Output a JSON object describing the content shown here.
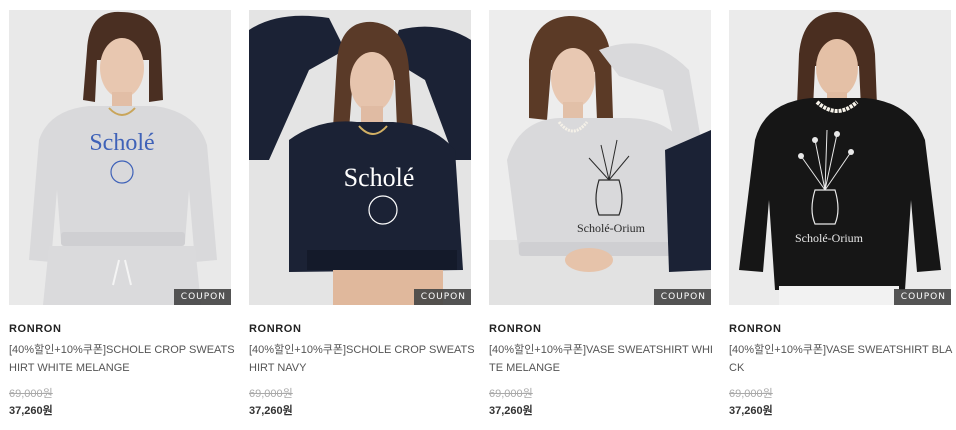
{
  "products": [
    {
      "brand": "RONRON",
      "name": "[40%할인+10%쿠폰]SCHOLE CROP SWEATSHIRT WHITE MELANGE",
      "original_price": "69,000원",
      "sale_price": "37,260원",
      "badge": "COUPON",
      "image_print": "Scholé"
    },
    {
      "brand": "RONRON",
      "name": "[40%할인+10%쿠폰]SCHOLE CROP SWEATSHIRT NAVY",
      "original_price": "69,000원",
      "sale_price": "37,260원",
      "badge": "COUPON",
      "image_print": "Scholé"
    },
    {
      "brand": "RONRON",
      "name": "[40%할인+10%쿠폰]VASE SWEATSHIRT WHITE MELANGE",
      "original_price": "69,000원",
      "sale_price": "37,260원",
      "badge": "COUPON",
      "image_print": "Scholé-Orium"
    },
    {
      "brand": "RONRON",
      "name": "[40%할인+10%쿠폰]VASE SWEATSHIRT BLACK",
      "original_price": "69,000원",
      "sale_price": "37,260원",
      "badge": "COUPON",
      "image_print": "Scholé-Orium"
    }
  ],
  "colors": {
    "melange": "#d9d9db",
    "navy": "#1b2235",
    "black": "#161616",
    "print_blue": "#3f62b8",
    "coupon_bg": "#464646"
  }
}
